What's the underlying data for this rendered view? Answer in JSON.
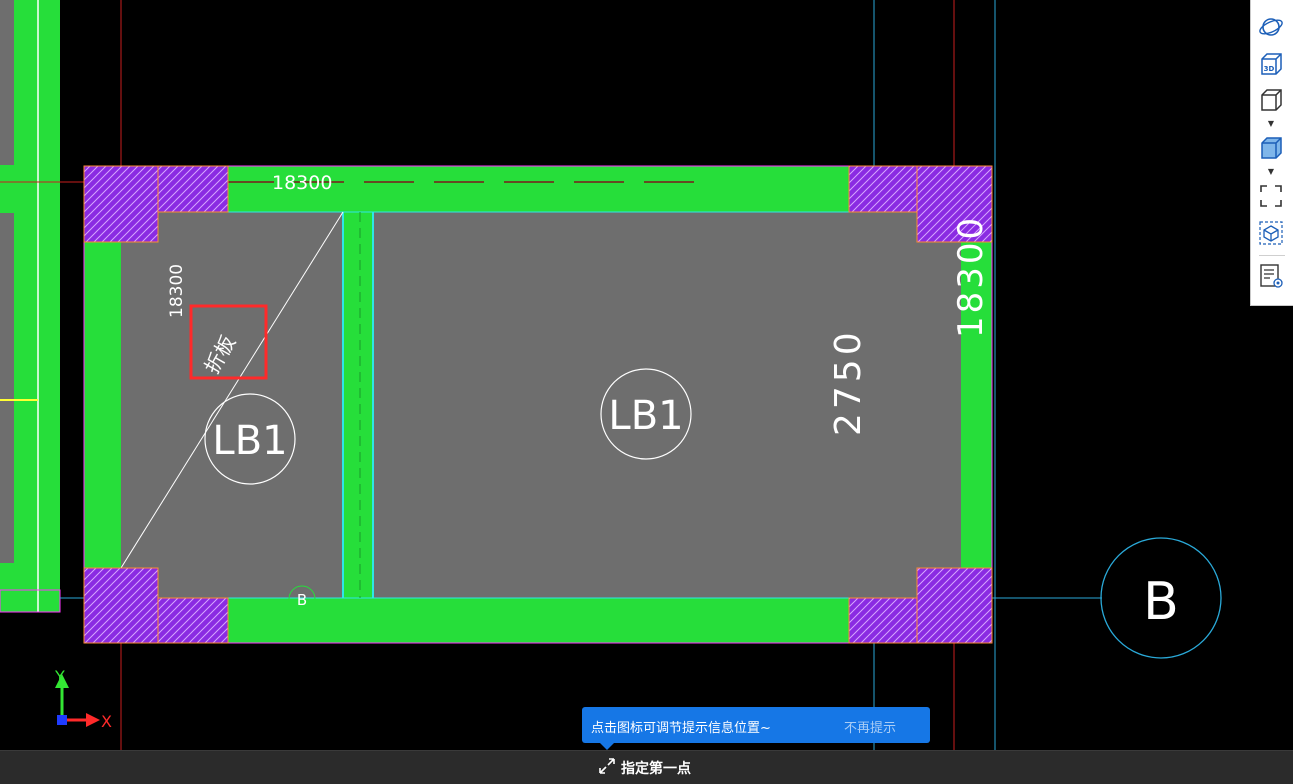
{
  "drawing": {
    "dimensions": {
      "top_span": "18300",
      "left_span": "18300",
      "right_span": "18300",
      "slab_span": "2750"
    },
    "slab_labels": [
      "LB1",
      "LB1"
    ],
    "highlighted_label": "折板",
    "axis_bubbles": {
      "small_axis": "B",
      "large_axis": "B"
    },
    "ucs": {
      "x_label": "X",
      "y_label": "Y"
    }
  },
  "colors": {
    "background": "#000000",
    "beam": "#26de3a",
    "slab": "#6e6e6e",
    "column_hatch": "#8a2be2",
    "highlight_box": "#ff2a2a",
    "tooltip": "#1677e6"
  },
  "toolbar": {
    "items": [
      {
        "icon": "orbit-icon"
      },
      {
        "icon": "3d-view-icon",
        "label": "3D"
      },
      {
        "icon": "wireframe-cube-icon"
      },
      {
        "icon": "shaded-cube-icon"
      },
      {
        "icon": "zoom-extents-icon"
      },
      {
        "icon": "isolate-view-icon"
      },
      {
        "icon": "properties-panel-icon"
      }
    ]
  },
  "tooltip": {
    "message": "点击图标可调节提示信息位置~",
    "dismiss": "不再提示"
  },
  "command": {
    "icon": "adjust-position-icon",
    "prompt": "指定第一点"
  }
}
